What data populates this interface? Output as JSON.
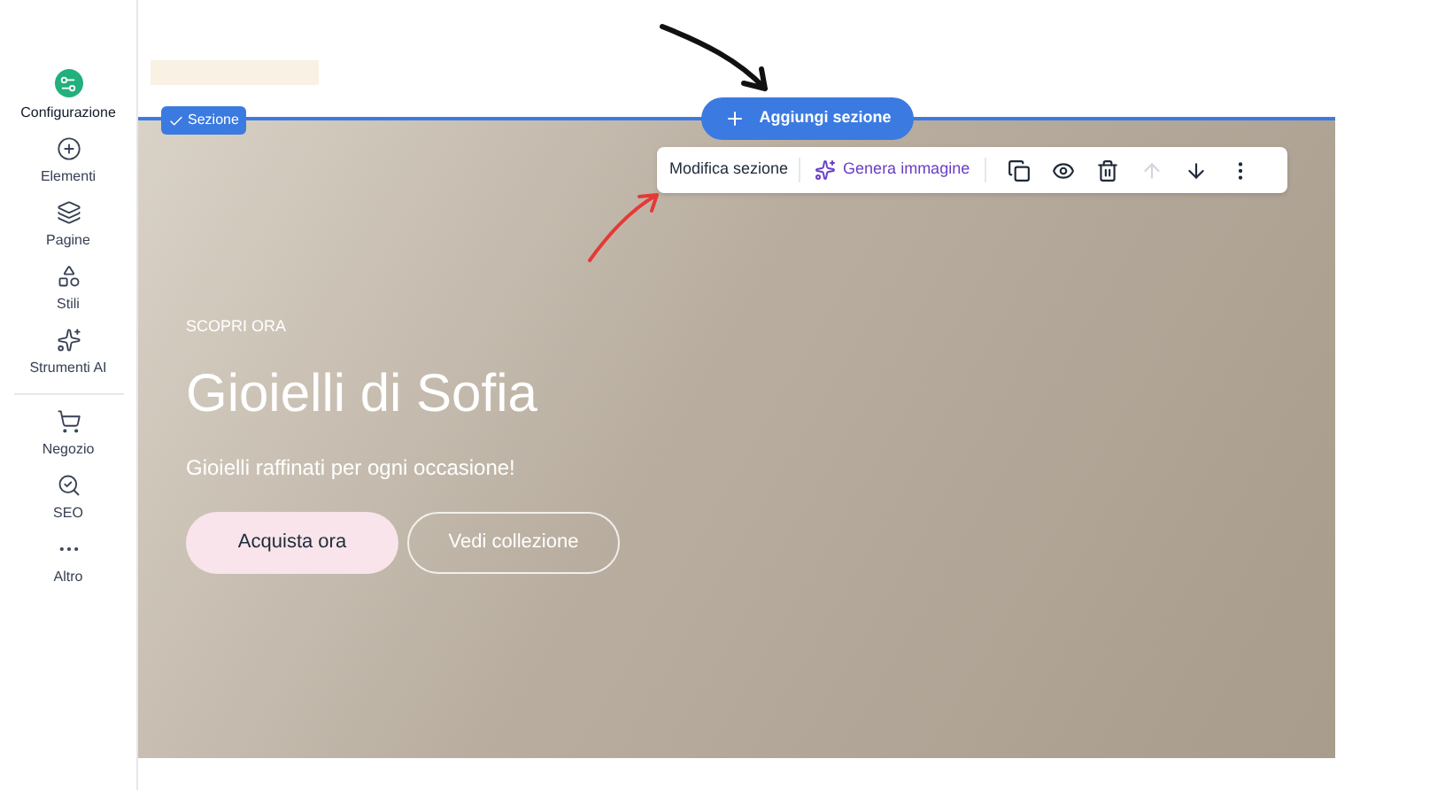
{
  "sidebar": {
    "items": [
      {
        "kind": "config",
        "label": "Configurazione",
        "selected": true
      },
      {
        "kind": "plus",
        "label": "Elementi",
        "selected": false
      },
      {
        "kind": "layers",
        "label": "Pagine",
        "selected": false
      },
      {
        "kind": "shapes",
        "label": "Stili",
        "selected": false
      },
      {
        "kind": "sparkles",
        "label": "Strumenti AI",
        "selected": false
      },
      {
        "kind": "cart",
        "label": "Negozio",
        "selected": false
      },
      {
        "kind": "seo",
        "label": "SEO",
        "selected": false
      },
      {
        "kind": "more",
        "label": "Altro",
        "selected": false
      }
    ]
  },
  "section_tag": "Sezione",
  "add_section_button": "Aggiungi sezione",
  "section_toolbar": {
    "edit_label": "Modifica sezione",
    "generate_image": "Genera immagine",
    "actions": [
      {
        "kind": "copy",
        "disabled": false
      },
      {
        "kind": "eye",
        "disabled": false
      },
      {
        "kind": "trash",
        "disabled": false
      },
      {
        "kind": "up",
        "disabled": true
      },
      {
        "kind": "down",
        "disabled": false
      },
      {
        "kind": "more",
        "disabled": false
      }
    ]
  },
  "hero": {
    "eyebrow": "SCOPRI ORA",
    "title": "Gioielli di Sofia",
    "subtitle": "Gioielli raffinati per ogni occasione!",
    "buttons": [
      {
        "kind": "primary",
        "label": "Acquista ora"
      },
      {
        "kind": "outline",
        "label": "Vedi collezione"
      }
    ]
  }
}
